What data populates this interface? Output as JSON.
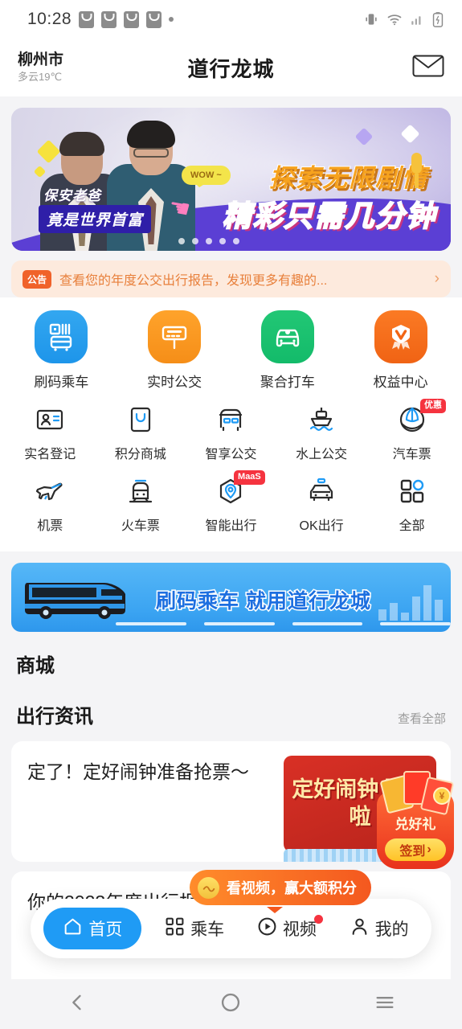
{
  "status_bar": {
    "time": "10:28",
    "icons": [
      "notification-icon",
      "notification-icon",
      "notification-icon",
      "notification-icon",
      "dot-indicator"
    ],
    "right_icons": [
      "vibrate-icon",
      "wifi-icon",
      "signal-icon",
      "battery-charging-icon"
    ]
  },
  "header": {
    "city": "柳州市",
    "weather": "多云19℃",
    "title": "道行龙城",
    "mail_icon": "mail-icon"
  },
  "banner": {
    "tag_line1": "保安老爸",
    "tag_line2": "竟是世界首富",
    "headline1": "探索无限剧情",
    "headline2": "精彩只需几分钟",
    "bubble": "WOW ~",
    "dots": 5,
    "active_dot": 0
  },
  "notice": {
    "badge": "公告",
    "text": "查看您的年度公交出行报告，发现更多有趣的...",
    "arrow": "chevron-right-icon"
  },
  "grid": {
    "row1": [
      {
        "label": "刷码乘车",
        "color": "#2196f3",
        "icon": "qr-bus-icon"
      },
      {
        "label": "实时公交",
        "color": "#f79018",
        "icon": "bus-stop-sign-icon"
      },
      {
        "label": "聚合打车",
        "color": "#18bd6d",
        "icon": "car-icon"
      },
      {
        "label": "权益中心",
        "color": "#f26514",
        "icon": "medal-icon"
      }
    ],
    "row2": [
      {
        "label": "实名登记",
        "icon": "id-card-icon",
        "badge": ""
      },
      {
        "label": "积分商城",
        "icon": "points-mall-icon",
        "badge": ""
      },
      {
        "label": "智享公交",
        "icon": "smart-bus-icon",
        "badge": ""
      },
      {
        "label": "水上公交",
        "icon": "ferry-icon",
        "badge": ""
      },
      {
        "label": "汽车票",
        "icon": "coach-ticket-icon",
        "badge": "优惠"
      }
    ],
    "row3": [
      {
        "label": "机票",
        "icon": "airplane-icon",
        "badge": ""
      },
      {
        "label": "火车票",
        "icon": "train-icon",
        "badge": ""
      },
      {
        "label": "智能出行",
        "icon": "location-pin-icon",
        "badge": "MaaS"
      },
      {
        "label": "OK出行",
        "icon": "taxi-icon",
        "badge": ""
      },
      {
        "label": "全部",
        "icon": "grid-all-icon",
        "badge": ""
      }
    ]
  },
  "promo": {
    "text": "刷码乘车 就用道行龙城",
    "icon": "blue-bus-illustration"
  },
  "sections": {
    "mall_title": "商城",
    "news_title": "出行资讯",
    "news_more": "查看全部"
  },
  "news": [
    {
      "title": "定了！定好闹钟准备抢票～",
      "thumb_text": "定好闹钟\n要抢啦"
    },
    {
      "title": "你的2023年度出行报告来..."
    }
  ],
  "gift_widget": {
    "label": "兑好礼",
    "button": "签到",
    "button_arrow": "›",
    "coin": "¥"
  },
  "tooltip": {
    "text": "看视频，赢大额积分",
    "icon": "coin-icon"
  },
  "bottom_nav": [
    {
      "label": "首页",
      "icon": "home-icon",
      "active": true,
      "dot": false
    },
    {
      "label": "乘车",
      "icon": "qr-ride-icon",
      "active": false,
      "dot": false
    },
    {
      "label": "视频",
      "icon": "play-circle-icon",
      "active": false,
      "dot": true
    },
    {
      "label": "我的",
      "icon": "person-icon",
      "active": false,
      "dot": false
    }
  ],
  "system_nav": [
    {
      "icon": "back-icon"
    },
    {
      "icon": "home-circle-icon"
    },
    {
      "icon": "recents-icon"
    }
  ],
  "colors": {
    "accent_blue": "#1f9bf5",
    "accent_orange": "#f0622a",
    "badge_red": "#f5333f",
    "page_bg": "#f4f4f6"
  }
}
